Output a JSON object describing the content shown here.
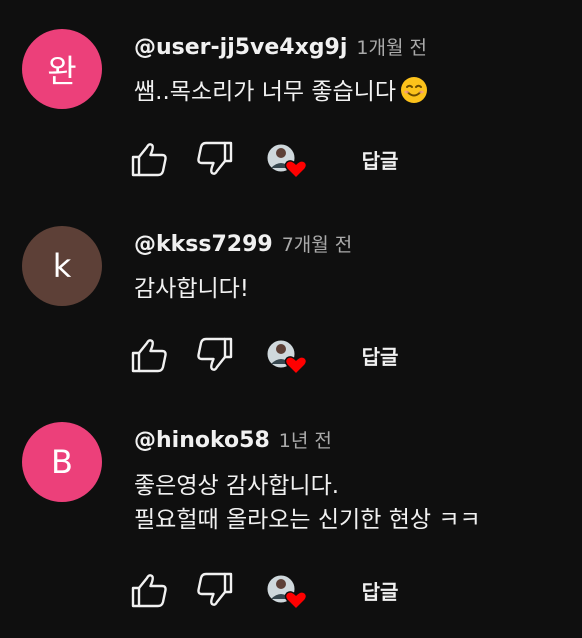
{
  "comments": [
    {
      "avatar_letter": "완",
      "avatar_color": "#ec407a",
      "author": "@user-jj5ve4xg9j",
      "time": "1개월 전",
      "lines": [
        "쌤..목소리가 너무 좋습니다"
      ],
      "emoji": "smiling-face-emoji",
      "reply_label": "답글"
    },
    {
      "avatar_letter": "k",
      "avatar_color": "#5d4037",
      "author": "@kkss7299",
      "time": "7개월 전",
      "lines": [
        "감사합니다!"
      ],
      "reply_label": "답글"
    },
    {
      "avatar_letter": "B",
      "avatar_color": "#ec407a",
      "author": "@hinoko58",
      "time": "1년 전",
      "lines": [
        "좋은영상 감사합니다.",
        "필요헐때 올라오는 신기한 현상 ㅋㅋ"
      ],
      "reply_label": "답글"
    }
  ],
  "colors": {
    "background": "#0f0f0f",
    "text": "#f1f1f1",
    "secondary_text": "#aaaaaa",
    "heart": "#ff0000"
  },
  "icons": {
    "like": "thumbs-up-icon",
    "dislike": "thumbs-down-icon",
    "creator_heart": "creator-heart-icon"
  }
}
